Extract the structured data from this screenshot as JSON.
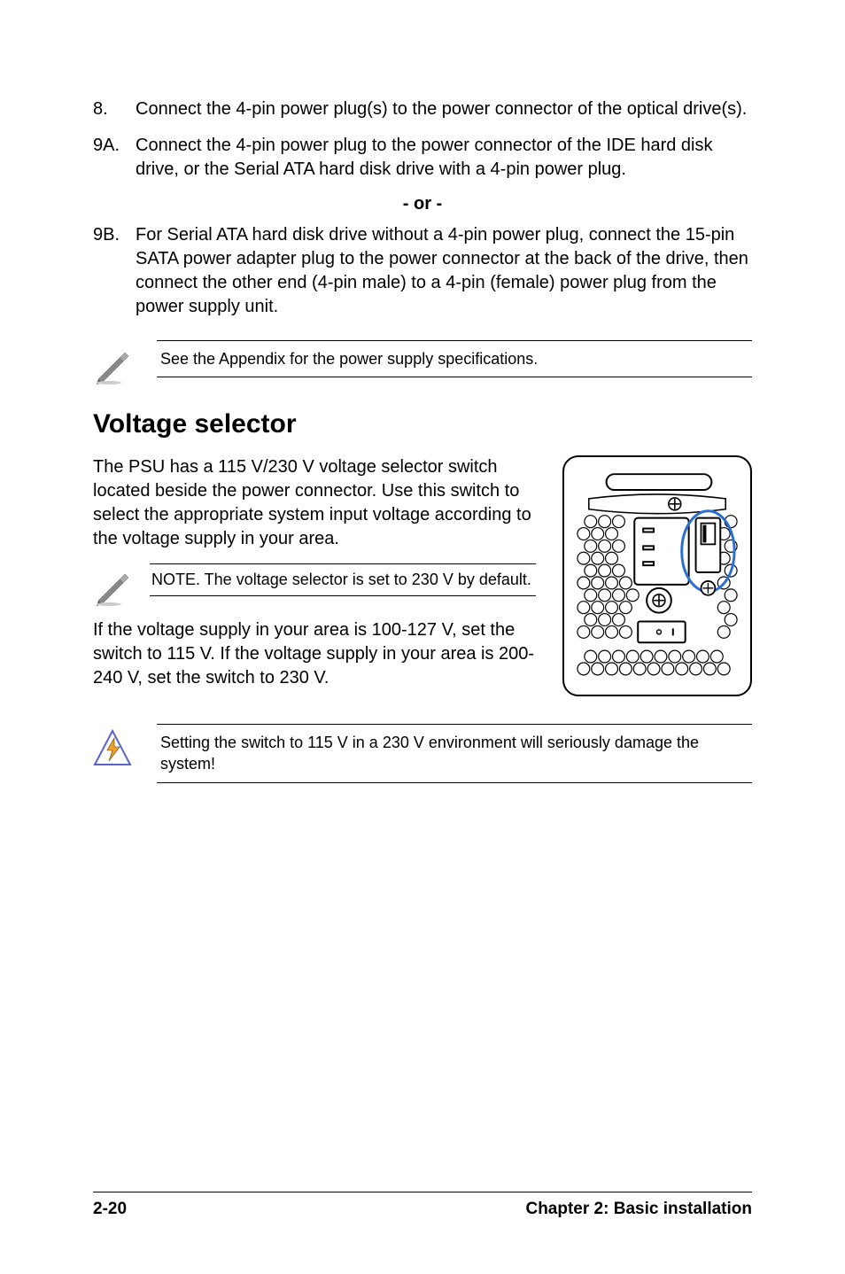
{
  "steps": {
    "s8": {
      "num": "8.",
      "text": "Connect the 4-pin power plug(s) to the power connector of the optical drive(s)."
    },
    "s9a": {
      "num": "9A.",
      "text": "Connect the 4-pin power plug to the power connector of the IDE hard disk drive, or the Serial ATA hard disk drive with a 4-pin power plug."
    },
    "or": "- or -",
    "s9b": {
      "num": "9B.",
      "text": "For Serial ATA hard disk drive without a 4-pin power plug, connect the 15-pin SATA power adapter plug to the power connector at the back of the drive, then connect the other end (4-pin male) to a 4-pin (female) power plug from the power supply unit."
    }
  },
  "note_appendix": "See the Appendix for the power supply specifications.",
  "heading": "Voltage selector",
  "vs_para1": "The PSU has a 115 V/230 V voltage selector switch located beside the power connector. Use this switch to select the appropriate system input voltage according to the voltage supply in your area.",
  "vs_note": "NOTE. The voltage selector is set to 230 V by default.",
  "vs_para2": "If the voltage supply in your area is 100-127 V, set the switch to 115 V. If the voltage supply in your area is 200-240 V, set the switch to 230 V.",
  "warning": "Setting the switch to 115 V in a 230 V environment will seriously damage the system!",
  "footer": {
    "page": "2-20",
    "chapter": "Chapter 2: Basic installation"
  }
}
